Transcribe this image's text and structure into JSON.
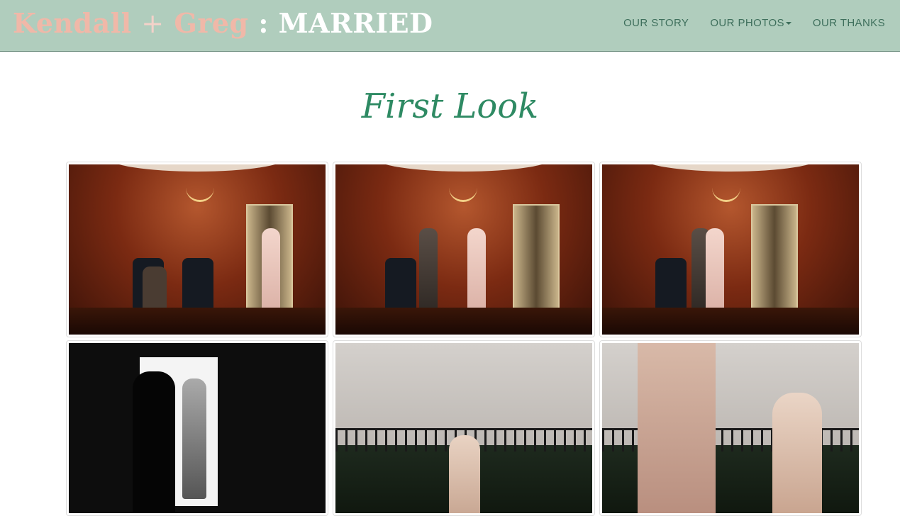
{
  "brand": {
    "first": "Kendall",
    "plus": "+",
    "second": "Greg",
    "suffix": " : MARRIED"
  },
  "nav": {
    "story": "OUR STORY",
    "photos": "OUR PHOTOS",
    "thanks": "OUR THANKS"
  },
  "section": {
    "title": "First Look"
  },
  "colors": {
    "navbar": "#b0cdbd",
    "title": "#2e8a63",
    "nav_text": "#3e6f5c",
    "brand_name": "#f0b8a8"
  }
}
